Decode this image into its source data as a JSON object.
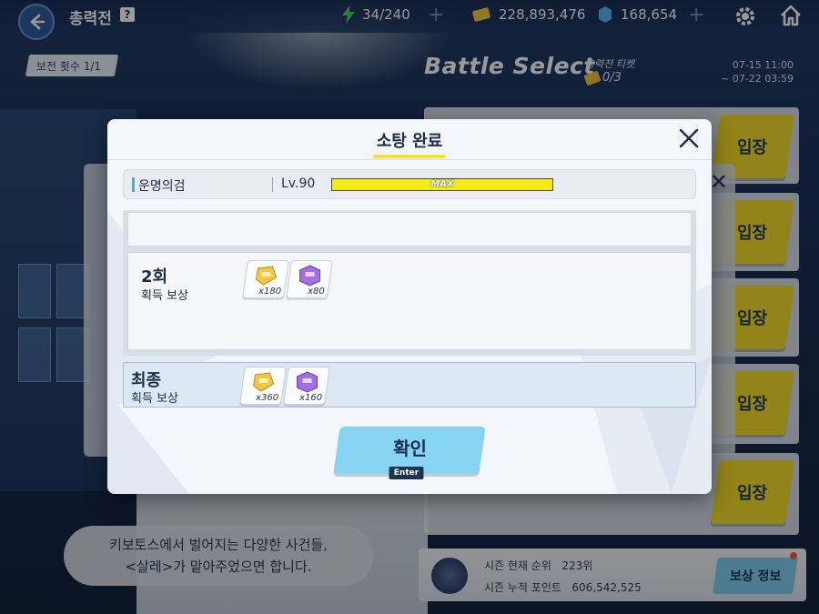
{
  "topbar": {
    "title": "총력전",
    "help": "?",
    "stamina": "34/240",
    "credits": "228,893,476",
    "pyroxene": "168,654"
  },
  "background": {
    "raid_count": "보전 횟수 1/1",
    "battle_select": "Battle Select",
    "ticket_label": "총력전 티켓",
    "ticket_count": "0/3",
    "date_start": "07-15 11:00",
    "date_end": "~ 07-22 03:59",
    "enter_label": "입장",
    "dialogue_line1": "키보토스에서 벌어지는 다양한 사건들,",
    "dialogue_line2": "<살레>가 맡아주었으면 합니다.",
    "season_rank_label": "시즌 현재 순위",
    "season_rank_value": "223위",
    "season_points_label": "시즌 누적 포인트",
    "season_points_value": "606,542,525",
    "reward_info": "보상 정보"
  },
  "modal": {
    "title": "소탕 완료",
    "character": {
      "name": "운명의검",
      "level": "Lv.90",
      "exp_text": "MAX",
      "exp_fraction": 1.0
    },
    "runs": [
      {
        "label": "2회",
        "sub": "획득 보상",
        "rewards": [
          {
            "icon": "gold-report-icon",
            "qty": "x180"
          },
          {
            "icon": "purple-report-icon",
            "qty": "x80"
          }
        ]
      }
    ],
    "final": {
      "label": "최종",
      "sub": "획득 보상",
      "rewards": [
        {
          "icon": "gold-report-icon",
          "qty": "x360"
        },
        {
          "icon": "purple-report-icon",
          "qty": "x160"
        }
      ]
    },
    "confirm_label": "확인",
    "confirm_hotkey": "Enter"
  },
  "colors": {
    "accent_yellow": "#f3e236",
    "confirm_blue": "#86d4f1",
    "enter_yellow": "#f3dd2a",
    "gold_item": "#f2c744",
    "purple_item": "#a36ee0"
  }
}
